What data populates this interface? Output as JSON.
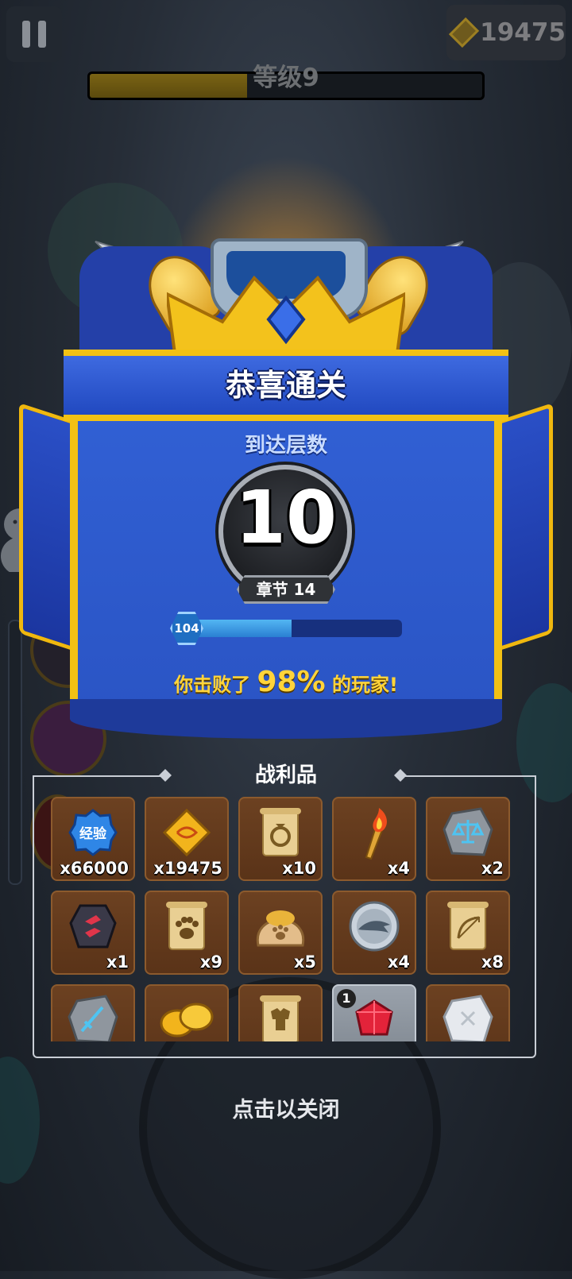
{
  "hud": {
    "coins": "19475",
    "level_label": "等级9",
    "level_progress": 0.4
  },
  "result": {
    "title": "恭喜通关",
    "floor_label": "到达层数",
    "floor": "10",
    "chapter": "章节 14",
    "exp_level": "104",
    "exp_progress": 0.5,
    "defeat_prefix": "你击败了",
    "defeat_percent": "98%",
    "defeat_suffix": "的玩家!"
  },
  "loot": {
    "title": "战利品",
    "items": [
      {
        "name": "exp",
        "label": "经验",
        "qty": "x66000"
      },
      {
        "name": "gold-diamond",
        "qty": "x19475"
      },
      {
        "name": "ring-scroll",
        "qty": "x10"
      },
      {
        "name": "torch",
        "qty": "x4"
      },
      {
        "name": "scale-rune-stone",
        "qty": "x2"
      },
      {
        "name": "red-rune-stone",
        "qty": "x1"
      },
      {
        "name": "paw-scroll",
        "qty": "x9"
      },
      {
        "name": "paw-sack",
        "qty": "x5"
      },
      {
        "name": "shark-coin",
        "qty": "x4"
      },
      {
        "name": "bow-scroll",
        "qty": "x8"
      },
      {
        "name": "sword-stone",
        "qty": ""
      },
      {
        "name": "gold-coins",
        "qty": ""
      },
      {
        "name": "armor-scroll",
        "qty": ""
      },
      {
        "name": "red-gem",
        "qty": "",
        "badge": "1"
      },
      {
        "name": "white-stone",
        "qty": ""
      }
    ]
  },
  "close_hint": "点击以关闭",
  "colors": {
    "banner_blue": "#3160d4",
    "gold_trim": "#f2c114",
    "exp_fill": "#53b6f3",
    "defeat_yellow": "#ffd43a",
    "item_bg": "#6c4121"
  }
}
